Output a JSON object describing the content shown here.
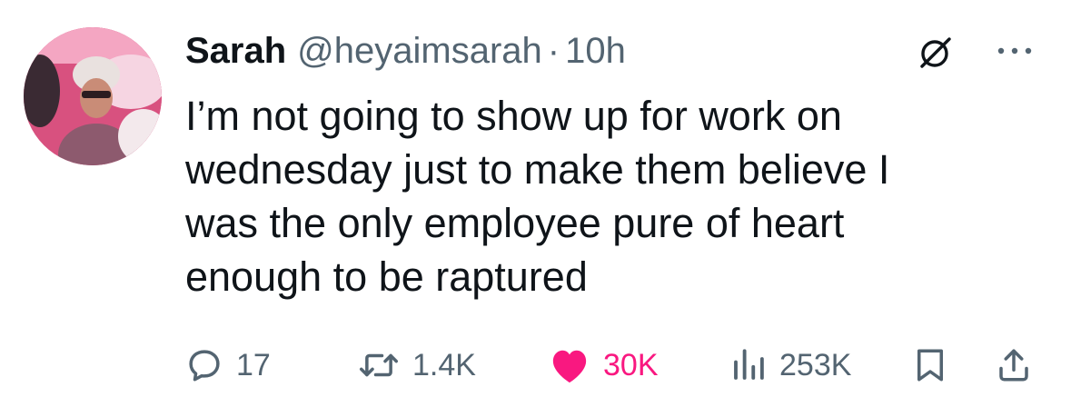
{
  "author": {
    "display_name": "Sarah",
    "handle": "@heyaimsarah",
    "separator": "·",
    "time": "10h",
    "avatar_icon": "profile-photo"
  },
  "tweet": {
    "text": "I’m not going to show up for work on\nwednesday just to make them believe I\nwas the only employee pure of heart\nenough to be raptured"
  },
  "actions": {
    "replies": "17",
    "retweets": "1.4K",
    "likes": "30K",
    "views": "253K"
  },
  "colors": {
    "text_primary": "#0f1419",
    "text_secondary": "#536471",
    "like_active": "#f91880"
  },
  "icons": {
    "grok": "grok-icon",
    "more": "more-options-icon",
    "reply": "reply-icon",
    "retweet": "retweet-icon",
    "like": "heart-icon",
    "views": "views-icon",
    "bookmark": "bookmark-icon",
    "share": "share-icon"
  }
}
